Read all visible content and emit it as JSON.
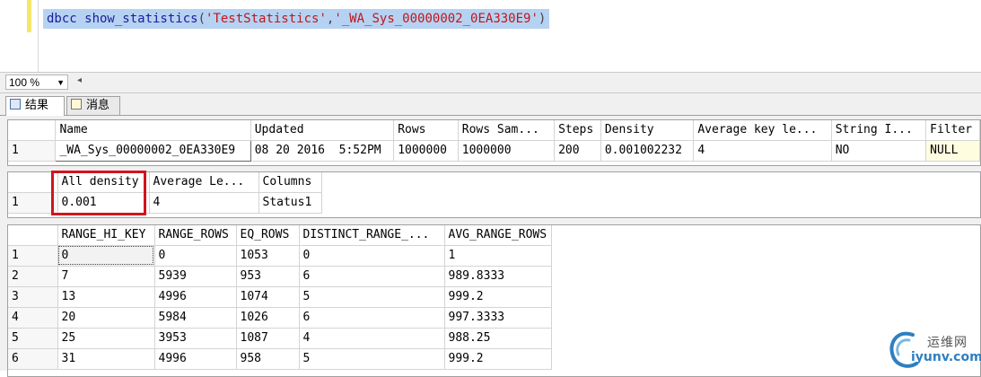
{
  "editor": {
    "query": {
      "keyword": "dbcc show_statistics",
      "open": "(",
      "arg1": "'TestStatistics'",
      "comma": ",",
      "arg2": "'_WA_Sys_00000002_0EA330E9'",
      "close": ")"
    }
  },
  "statusbar": {
    "zoom": "100 %"
  },
  "tabs": [
    {
      "label": "结果",
      "icon": "grid-icon",
      "active": true
    },
    {
      "label": "消息",
      "icon": "messages-icon",
      "active": false
    }
  ],
  "grid1": {
    "headers": [
      "",
      "Name",
      "Updated",
      "Rows",
      "Rows Sam...",
      "Steps",
      "Density",
      "Average key le...",
      "String I...",
      "Filter"
    ],
    "rows": [
      [
        "1",
        "_WA_Sys_00000002_0EA330E9",
        "08 20 2016  5:52PM",
        "1000000",
        "1000000",
        "200",
        "0.001002232",
        "4",
        "NO",
        "NULL"
      ]
    ]
  },
  "grid2": {
    "headers": [
      "",
      "All density",
      "Average Le...",
      "Columns"
    ],
    "rows": [
      [
        "1",
        "0.001",
        "4",
        "Status1"
      ]
    ]
  },
  "grid3": {
    "headers": [
      "",
      "RANGE_HI_KEY",
      "RANGE_ROWS",
      "EQ_ROWS",
      "DISTINCT_RANGE_...",
      "AVG_RANGE_ROWS"
    ],
    "rows": [
      [
        "1",
        "0",
        "0",
        "1053",
        "0",
        "1"
      ],
      [
        "2",
        "7",
        "5939",
        "953",
        "6",
        "989.8333"
      ],
      [
        "3",
        "13",
        "4996",
        "1074",
        "5",
        "999.2"
      ],
      [
        "4",
        "20",
        "5984",
        "1026",
        "6",
        "997.3333"
      ],
      [
        "5",
        "25",
        "3953",
        "1087",
        "4",
        "988.25"
      ],
      [
        "6",
        "31",
        "4996",
        "958",
        "5",
        "999.2"
      ]
    ]
  },
  "watermark": {
    "cn": "运维网",
    "en": "iyunv.com"
  },
  "colors": {
    "highlight": "#b6d2f2",
    "keyword": "#1c1c9a",
    "string": "#c0161b",
    "callout": "#d3131e"
  }
}
